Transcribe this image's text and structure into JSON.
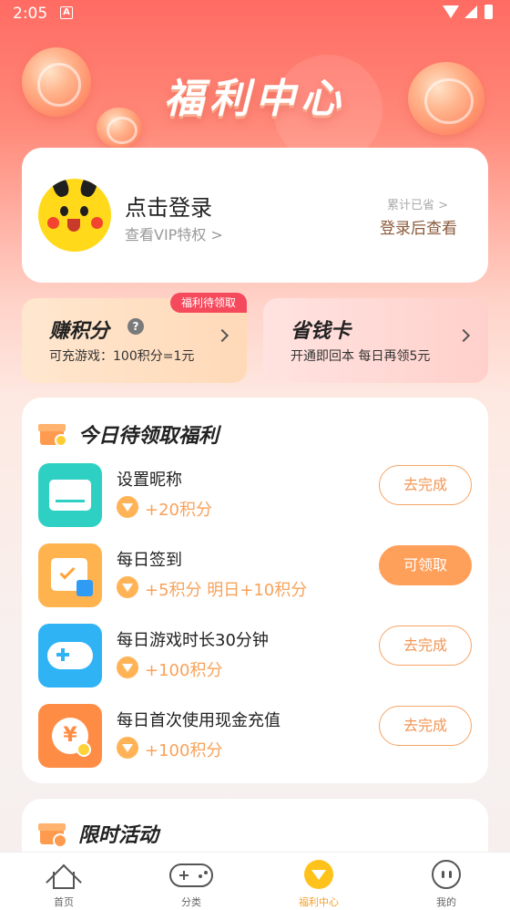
{
  "status_bar": {
    "time": "2:05",
    "notification_icon": "A"
  },
  "header": {
    "title": "福利中心"
  },
  "user_card": {
    "login_title": "点击登录",
    "vip_link": "查看VIP特权 >",
    "saved_label": "累计已省 >",
    "saved_value": "登录后查看"
  },
  "promos": {
    "points": {
      "title": "赚积分",
      "help": "?",
      "subtitle": "可充游戏：100积分=1元",
      "badge": "福利待领取"
    },
    "saving_card": {
      "title": "省钱卡",
      "subtitle": "开通即回本 每日再领5元"
    }
  },
  "today_section": {
    "title": "今日待领取福利",
    "tasks": [
      {
        "name": "设置昵称",
        "reward": "+20积分",
        "button": "去完成",
        "icon": "edit-card-icon"
      },
      {
        "name": "每日签到",
        "reward": "+5积分 明日+10积分",
        "button": "可领取",
        "icon": "calendar-icon"
      },
      {
        "name": "每日游戏时长30分钟",
        "reward": "+100积分",
        "button": "去完成",
        "icon": "gamepad-icon"
      },
      {
        "name": "每日首次使用现金充值",
        "reward": "+100积分",
        "button": "去完成",
        "icon": "yuan-icon",
        "icon_text": "¥"
      }
    ]
  },
  "limited_section": {
    "title": "限时活动"
  },
  "bottom_nav": {
    "items": [
      {
        "label": "首页",
        "icon": "home-icon"
      },
      {
        "label": "分类",
        "icon": "gamepad-icon"
      },
      {
        "label": "福利中心",
        "icon": "welfare-icon",
        "active": true
      },
      {
        "label": "我的",
        "icon": "face-icon"
      }
    ]
  },
  "colors": {
    "accent": "#ffa05a",
    "header_red": "#ff6b63",
    "active_nav": "#f5a02a",
    "badge": "#f44a5c"
  }
}
